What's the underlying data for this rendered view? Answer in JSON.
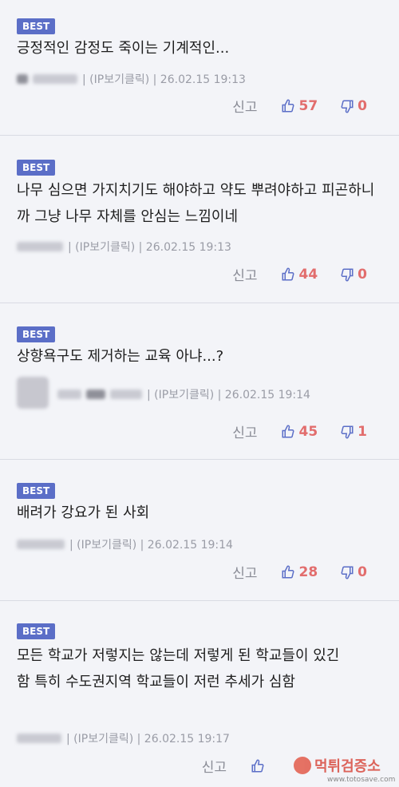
{
  "comments": [
    {
      "badge": "BEST",
      "text": "긍정적인 감정도 죽이는 기계적인...",
      "meta": "| (IP보기클릭) | 26.02.15 19:13",
      "report": "신고",
      "up": "57",
      "down": "0"
    },
    {
      "badge": "BEST",
      "text": "나무 심으면 가지치기도 해야하고 약도 뿌려야하고 피곤하니까 그냥 나무 자체를 안심는 느낌이네",
      "meta": "| (IP보기클릭) | 26.02.15 19:13",
      "report": "신고",
      "up": "44",
      "down": "0"
    },
    {
      "badge": "BEST",
      "text": "상향욕구도 제거하는 교육 아냐...?",
      "meta": "| (IP보기클릭) | 26.02.15 19:14",
      "report": "신고",
      "up": "45",
      "down": "1"
    },
    {
      "badge": "BEST",
      "text": "배려가 강요가 된 사회",
      "meta": "| (IP보기클릭) | 26.02.15 19:14",
      "report": "신고",
      "up": "28",
      "down": "0"
    },
    {
      "badge": "BEST",
      "text": "모든 학교가 저렇지는 않는데 저렇게 된 학교들이 있긴 함 특히 수도권지역 학교들이 저런 추세가 심함",
      "meta": "| (IP보기클릭) | 26.02.15 19:17",
      "report": "신고",
      "up": "",
      "down": ""
    }
  ],
  "watermark": {
    "brand": "먹튀검증소",
    "url": "www.totosave.com"
  },
  "colors": {
    "badge": "#5b6ec7",
    "count": "#e26d6d",
    "icon": "#5b6ec7"
  }
}
